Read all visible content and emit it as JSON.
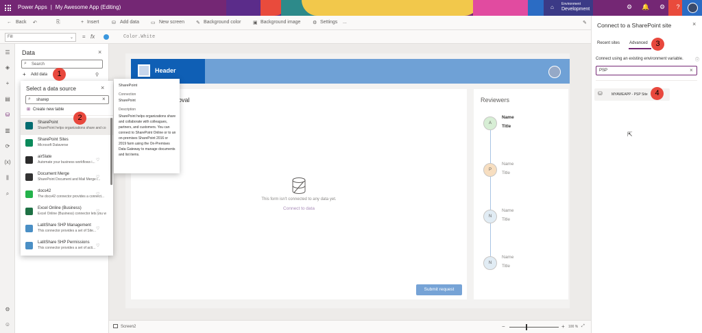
{
  "app": {
    "name": "Power Apps",
    "separator": "|",
    "title": "My Awesome App (Editing)",
    "environment_label": "Environment",
    "environment_value": "Development"
  },
  "command_bar": {
    "back": "Back",
    "insert": "Insert",
    "add_data": "Add data",
    "new_screen": "New screen",
    "background_color": "Background color",
    "background_image": "Background image",
    "settings": "Settings",
    "more": "..."
  },
  "formula_bar": {
    "property": "Fill",
    "equals": "=",
    "fx": "fx",
    "value": "Color.White"
  },
  "data_pane": {
    "title": "Data",
    "search_placeholder": "Search",
    "add_data": "Add data"
  },
  "data_source_dialog": {
    "title": "Select a data source",
    "search_value": "sharep",
    "create_new": "Create new table",
    "items": [
      {
        "name": "SharePoint",
        "desc": "SharePoint helps organizations share and co...",
        "color": "#036c70"
      },
      {
        "name": "SharePoint Sites",
        "desc": "Microsoft Dataverse",
        "color": "#0b8a5b"
      },
      {
        "name": "airSlate",
        "desc": "Automate your business workflows i...",
        "color": "#2b2b2b"
      },
      {
        "name": "Document Merge",
        "desc": "SharePoint Document and Mail Merge i...",
        "color": "#333333"
      },
      {
        "name": "docs42",
        "desc": "The docs42 connector provides a connect...",
        "color": "#24b24b"
      },
      {
        "name": "Excel Online (Business)",
        "desc": "Excel Online (Business) connector lets you w...",
        "color": "#1e7145"
      },
      {
        "name": "LatitShare SHP Management",
        "desc": "This connector provides a set of Site...",
        "color": "#4a8fc5"
      },
      {
        "name": "LatitShare SHP Permissions",
        "desc": "This connector provides a set of acti...",
        "color": "#4a8fc5"
      }
    ]
  },
  "tooltip": {
    "title": "SharePoint",
    "connection_label": "Connection",
    "connection_value": "SharePoint",
    "description_label": "Description",
    "description": "SharePoint helps organizations share and collaborate with colleagues, partners, and customers. You can connect to SharePoint Online or to an on-premises SharePoint 2016 or 2019 farm using the On-Premises Data Gateway to manage documents and list items."
  },
  "canvas": {
    "header": "Header",
    "form_title": "roval",
    "empty_message": "This form isn't connected to any data yet.",
    "connect_link": "Connect to data",
    "submit": "Submit request",
    "reviewers_title": "Reviewers",
    "reviewers": [
      {
        "initial": "A",
        "name": "Name",
        "title": "Title",
        "color": "#d7eed5",
        "bold": true
      },
      {
        "initial": "P",
        "name": "Name",
        "title": "Title",
        "color": "#f7dec0",
        "bold": false
      },
      {
        "initial": "N",
        "name": "Name",
        "title": "Title",
        "color": "#e1ecf4",
        "bold": false
      },
      {
        "initial": "N",
        "name": "Name",
        "title": "Title",
        "color": "#e1ecf4",
        "bold": false
      }
    ]
  },
  "status_bar": {
    "screen": "Screen2",
    "zoom": "100 %"
  },
  "right_panel": {
    "title": "Connect to a SharePoint site",
    "tabs": [
      "Recent sites",
      "Advanced"
    ],
    "active_tab": "Advanced",
    "env_var_label": "Connect using an existing environment variable.",
    "search_value": "PSP",
    "result": "MYAWEAPP - PSP Site"
  },
  "callouts": [
    "1",
    "2",
    "3",
    "4"
  ],
  "colors": {
    "brand": "#742774",
    "accent": "#0f6cbd",
    "callout": "#e8483d"
  }
}
